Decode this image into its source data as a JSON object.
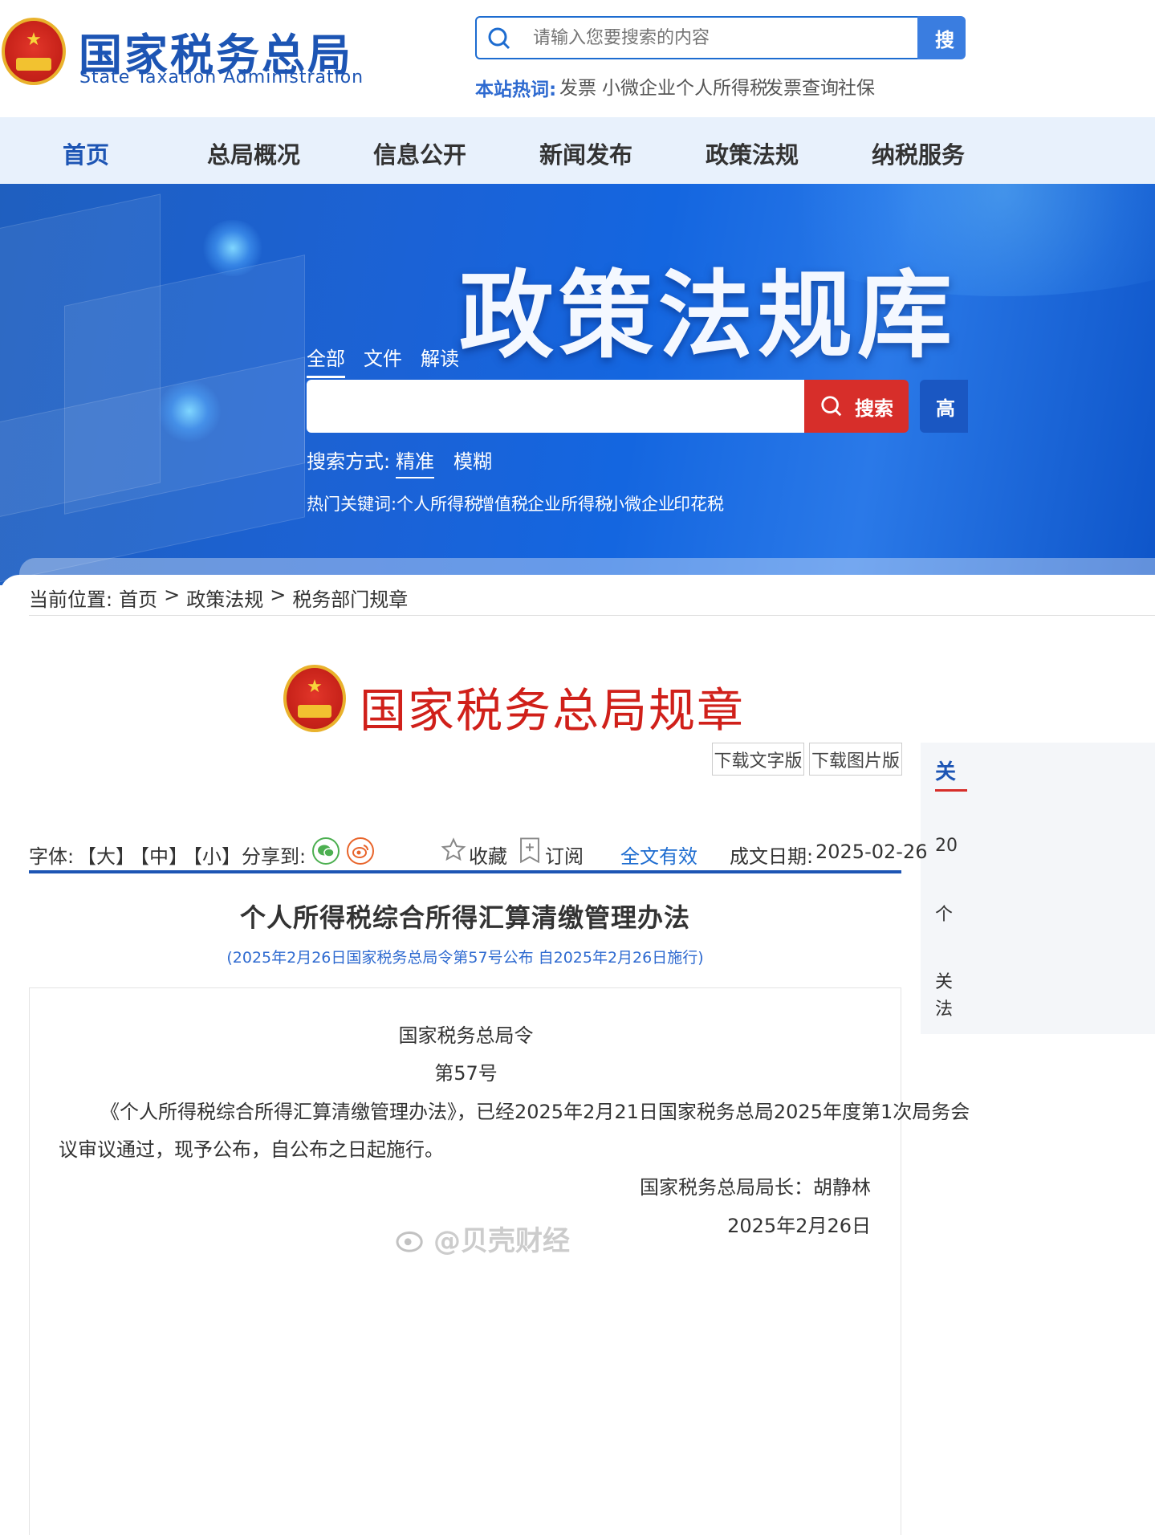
{
  "header": {
    "logo_cn": "国家税务总局",
    "logo_en": "State Taxation Administration",
    "search_placeholder": "请输入您要搜索的内容",
    "search_button": "搜",
    "hot_label": "本站热词:",
    "hot_words": [
      "发票",
      "小微企业",
      "个人所得税",
      "发票查询",
      "社保"
    ]
  },
  "nav": {
    "items": [
      "首页",
      "总局概况",
      "信息公开",
      "新闻发布",
      "政策法规",
      "纳税服务"
    ]
  },
  "banner": {
    "title": "政策法规库",
    "tabs": [
      "全部",
      "文件",
      "解读"
    ],
    "search_button": "搜索",
    "advanced_button": "高",
    "mode_label": "搜索方式:",
    "modes": [
      "精准",
      "模糊"
    ],
    "hot_keywords_label": "热门关键词:",
    "hot_keywords": [
      "个人所得税",
      "增值税",
      "企业所得税",
      "小微企业",
      "印花税"
    ]
  },
  "breadcrumb": {
    "label": "当前位置:",
    "items": [
      "首页",
      "政策法规",
      "税务部门规章"
    ],
    "separator": ">"
  },
  "regulation": {
    "header_title": "国家税务总局规章",
    "download_text": "下载文字版",
    "download_image": "下载图片版"
  },
  "sidebar_partial": {
    "heading": "关",
    "lines": [
      "20",
      "个",
      "关",
      "法"
    ]
  },
  "toolbar": {
    "font_label": "字体:",
    "font_sizes": [
      "【大】",
      "【中】",
      "【小】"
    ],
    "share_label": "分享到:",
    "favorite": "收藏",
    "subscribe": "订阅",
    "status": "全文有效",
    "date_label": "成文日期:",
    "date": "2025-02-26"
  },
  "article": {
    "title": "个人所得税综合所得汇算清缴管理办法",
    "subtitle": "(2025年2月26日国家税务总局令第57号公布 自2025年2月26日施行)",
    "decree_org": "国家税务总局令",
    "decree_no": "第57号",
    "body_line1": "《个人所得税综合所得汇算清缴管理办法》，已经2025年2月21日国家税务总局2025年度第1次局务会",
    "body_line2": "议审议通过，现予公布，自公布之日起施行。",
    "signature": "国家税务总局局长：胡静林",
    "sign_date": "2025年2月26日"
  },
  "watermark": "@贝壳财经",
  "colors": {
    "brand_blue": "#1d55b4",
    "nav_bg": "#e8f1fc",
    "search_red": "#d72e2a",
    "title_red": "#d0201a"
  }
}
